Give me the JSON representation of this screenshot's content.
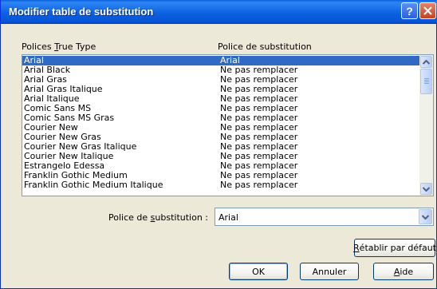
{
  "window": {
    "title": "Modifier table de substitution"
  },
  "titlebar": {
    "help_label": "?"
  },
  "list": {
    "col1_header": {
      "before": "Polices ",
      "mnemonic": "T",
      "after": "rue Type"
    },
    "col2_header": "Police de substitution",
    "rows": [
      {
        "font": "Arial",
        "substitute": "Arial",
        "selected": true
      },
      {
        "font": "Arial Black",
        "substitute": "Ne pas remplacer"
      },
      {
        "font": "Arial Gras",
        "substitute": "Ne pas remplacer"
      },
      {
        "font": "Arial Gras Italique",
        "substitute": "Ne pas remplacer"
      },
      {
        "font": "Arial Italique",
        "substitute": "Ne pas remplacer"
      },
      {
        "font": "Comic Sans MS",
        "substitute": "Ne pas remplacer"
      },
      {
        "font": "Comic Sans MS Gras",
        "substitute": "Ne pas remplacer"
      },
      {
        "font": "Courier New",
        "substitute": "Ne pas remplacer"
      },
      {
        "font": "Courier New Gras",
        "substitute": "Ne pas remplacer"
      },
      {
        "font": "Courier New Gras Italique",
        "substitute": "Ne pas remplacer"
      },
      {
        "font": "Courier New Italique",
        "substitute": "Ne pas remplacer"
      },
      {
        "font": "Estrangelo Edessa",
        "substitute": "Ne pas remplacer"
      },
      {
        "font": "Franklin Gothic Medium",
        "substitute": "Ne pas remplacer"
      },
      {
        "font": "Franklin Gothic Medium Italique",
        "substitute": "Ne pas remplacer"
      }
    ]
  },
  "substitution": {
    "label": {
      "before": "Police de ",
      "mnemonic": "s",
      "after": "ubstitution :"
    },
    "value": "Arial"
  },
  "buttons": {
    "reset": {
      "mnemonic": "R",
      "after": "établir par défaut"
    },
    "ok": "OK",
    "cancel": "Annuler",
    "help": {
      "mnemonic": "A",
      "after": "ide"
    }
  },
  "colors": {
    "titlebar": "#0b61e0",
    "selection": "#316ac5",
    "dialog_bg": "#ece9d8",
    "close_button": "#c8431c"
  },
  "icons": [
    "help-icon",
    "close-icon",
    "scroll-up-icon",
    "scroll-down-icon",
    "dropdown-arrow-icon"
  ]
}
